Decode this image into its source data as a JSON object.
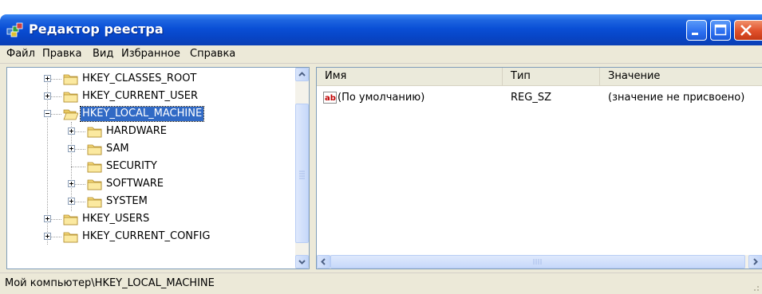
{
  "window": {
    "title": "Редактор реестра"
  },
  "menu": [
    {
      "label": "Файл"
    },
    {
      "label": "Правка"
    },
    {
      "label": "Вид"
    },
    {
      "label": "Избранное"
    },
    {
      "label": "Справка"
    }
  ],
  "tree": {
    "classes_root": "HKEY_CLASSES_ROOT",
    "current_user": "HKEY_CURRENT_USER",
    "local_machine": "HKEY_LOCAL_MACHINE",
    "hardware": "HARDWARE",
    "sam": "SAM",
    "security": "SECURITY",
    "software": "SOFTWARE",
    "system": "SYSTEM",
    "users": "HKEY_USERS",
    "current_config": "HKEY_CURRENT_CONFIG"
  },
  "list": {
    "columns": {
      "name": "Имя",
      "type": "Тип",
      "value": "Значение"
    },
    "rows": [
      {
        "name": "(По умолчанию)",
        "type": "REG_SZ",
        "value": "(значение не присвоено)"
      }
    ]
  },
  "status": {
    "path": "Мой компьютер\\HKEY_LOCAL_MACHINE"
  },
  "colors": {
    "titlebar": "#0a4fd6",
    "selection": "#316ac5",
    "chrome": "#ece9d8"
  },
  "icons": [
    "regedit-icon",
    "folder-icon",
    "open-folder-icon",
    "string-value-icon",
    "minimize-icon",
    "maximize-icon",
    "close-icon"
  ]
}
